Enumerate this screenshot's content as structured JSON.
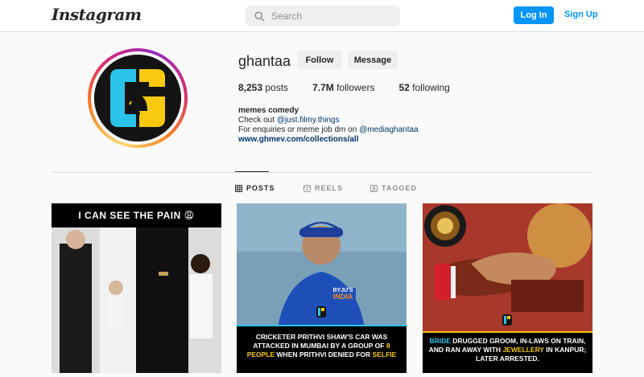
{
  "header": {
    "logo": "Instagram",
    "search_placeholder": "Search",
    "login_label": "Log In",
    "signup_label": "Sign Up"
  },
  "profile": {
    "username": "ghantaa",
    "follow_label": "Follow",
    "message_label": "Message",
    "stats": {
      "posts_count": "8,253",
      "posts_label": "posts",
      "followers_count": "7.7M",
      "followers_label": "followers",
      "following_count": "52",
      "following_label": "following"
    },
    "bio": {
      "name": "memes comedy",
      "line1_prefix": "Check out ",
      "line1_link": "@just.filmy.things",
      "line2_prefix": "For enquiries or meme job dm on ",
      "line2_link": "@mediaghantaa",
      "website": "www.ghmev.com/collections/all"
    }
  },
  "tabs": [
    {
      "label": "POSTS",
      "icon": "grid-icon",
      "active": true
    },
    {
      "label": "REELS",
      "icon": "reels-icon",
      "active": false
    },
    {
      "label": "TAGGED",
      "icon": "tag-icon",
      "active": false
    }
  ],
  "posts": [
    {
      "banner": "I CAN SEE THE PAIN 😩"
    },
    {
      "caption_pre": "CRICKETER PRITHVI SHAW'S CAR WAS ATTACKED IN MUMBAI BY A GROUP OF ",
      "caption_hl1": "8 PEOPLE",
      "caption_mid": " WHEN PRITHVI DENIED FOR ",
      "caption_hl2": "SELFIE",
      "jersey_text": "BYJU'S INDIA"
    },
    {
      "caption_hl1": "BRIDE",
      "caption_mid1": " DRUGGED GROOM, IN-LAWS ON TRAIN, AND RAN AWAY WITH ",
      "caption_hl2": "JEWELLERY",
      "caption_mid2": " IN KANPUR; LATER ARRESTED."
    }
  ],
  "colors": {
    "accent_blue": "#0095f6",
    "brand_yellow": "#f7c90f",
    "brand_cyan": "#2bc3ea"
  }
}
